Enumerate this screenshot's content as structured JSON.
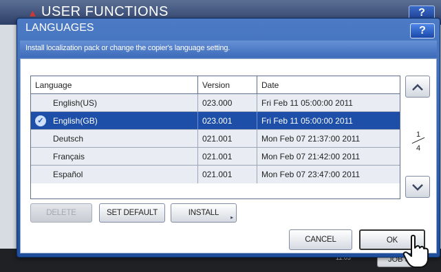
{
  "background": {
    "title": "USER FUNCTIONS",
    "help_label": "?",
    "clock": "11:05",
    "job_button": "JOB S"
  },
  "dialog": {
    "title": "LANGUAGES",
    "help_label": "?",
    "description": "Install localization pack or change the copier's language setting.",
    "table": {
      "headers": [
        "Language",
        "Version",
        "Date"
      ],
      "rows": [
        {
          "language": "English(US)",
          "version": "023.000",
          "date": "Fri Feb 11 05:00:00 2011",
          "selected": false
        },
        {
          "language": "English(GB)",
          "version": "023.001",
          "date": "Fri Feb 11 05:00:00 2011",
          "selected": true
        },
        {
          "language": "Deutsch",
          "version": "021.001",
          "date": "Mon Feb 07 21:37:00 2011",
          "selected": false
        },
        {
          "language": "Français",
          "version": "021.001",
          "date": "Mon Feb 07 21:42:00 2011",
          "selected": false
        },
        {
          "language": "Español",
          "version": "021.001",
          "date": "Mon Feb 07 23:47:00 2011",
          "selected": false
        }
      ]
    },
    "pager": {
      "current": "1",
      "total": "4"
    },
    "buttons": {
      "delete": "DELETE",
      "set_default": "SET DEFAULT",
      "install": "INSTALL",
      "cancel": "CANCEL",
      "ok": "OK"
    }
  },
  "colors": {
    "dialog_blue": "#1f4f9c",
    "selected_row": "#1d4fa8",
    "row_bg": "#e9ecf2"
  },
  "icons": [
    "scroll-up-icon",
    "scroll-down-icon",
    "selected-check-icon",
    "pointing-hand-icon",
    "submenu-arrow-icon"
  ]
}
